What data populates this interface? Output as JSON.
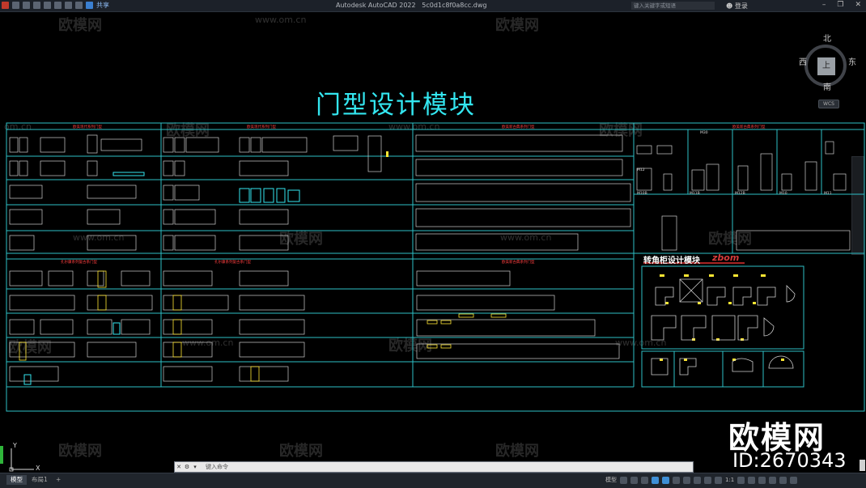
{
  "app": {
    "name": "Autodesk AutoCAD 2022",
    "file": "5c0d1c8f0a8cc.dwg",
    "share_label": "共享",
    "search_placeholder": "键入关键字或短语",
    "login_label": "登录"
  },
  "watermarks": {
    "brand": "欧模网",
    "url": "www.om.cn",
    "url_short": "om.cn"
  },
  "drawing": {
    "title": "门型设计模块",
    "corner_panel_title": "转角柜设计模块",
    "corner_brand": "zbom",
    "sections": {
      "t1": "欧美现代系列门型",
      "t2": "欧美现代系列门型",
      "t3": "欧美新古典系列门型",
      "t4": "欧美新古典系列门型",
      "b1": "孔尔康系列复古系门型",
      "b2": "孔尔康系列复古系门型",
      "b3": "欧美新古典系列门型"
    },
    "labels": [
      "M30",
      "M10B",
      "M11B",
      "M12B",
      "M10",
      "M11",
      "M12"
    ]
  },
  "viewcube": {
    "north": "北",
    "south": "南",
    "east": "东",
    "west": "西",
    "top": "上",
    "wcs": "WCS"
  },
  "ucs": {
    "x": "X",
    "y": "Y"
  },
  "command": {
    "prompt": "键入命令"
  },
  "status": {
    "tab_model": "模型",
    "tab_layout1": "布局1",
    "add_tab": "+",
    "model_space": "模型",
    "grid_icon": "grid-icon",
    "scale": "1:1"
  },
  "overlay_logo": {
    "name": "欧模网",
    "id": "ID:2670343"
  },
  "colors": {
    "cyan": "#2ec0c6",
    "title_cyan": "#33e6f0",
    "yellow": "#ffe633",
    "red": "#e03030"
  }
}
